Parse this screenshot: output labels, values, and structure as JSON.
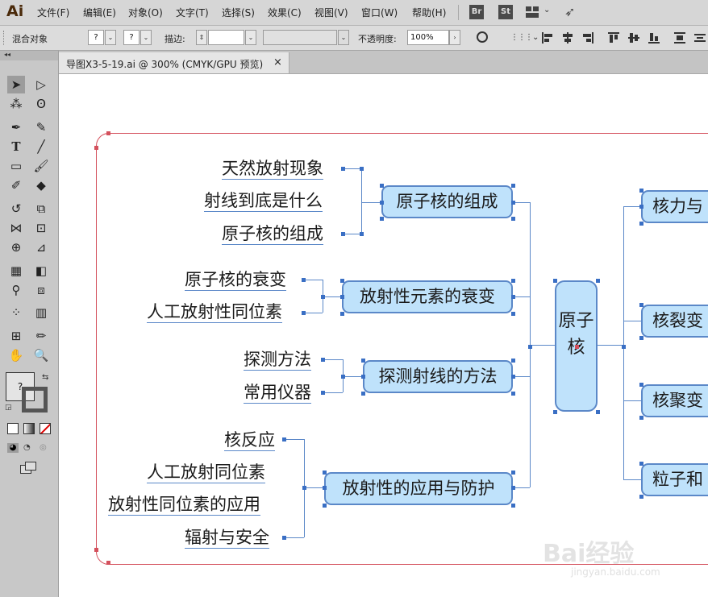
{
  "app": {
    "logo": "Ai"
  },
  "menu": [
    "文件(F)",
    "编辑(E)",
    "对象(O)",
    "文字(T)",
    "选择(S)",
    "效果(C)",
    "视图(V)",
    "窗口(W)",
    "帮助(H)"
  ],
  "menu_badges": [
    "Br",
    "St"
  ],
  "control_bar": {
    "selection_label": "混合对象",
    "fill_value": "?",
    "stroke_value": "?",
    "stroke_label": "描边:",
    "opacity_label": "不透明度:",
    "opacity_value": "100%"
  },
  "document_tab": {
    "title": "导图X3-5-19.ai @ 300% (CMYK/GPU 预览)",
    "close": "×"
  },
  "toolbar": {
    "fill_stroke_value": "?"
  },
  "mindmap": {
    "center": "原子核",
    "groups": [
      {
        "label": "原子核的组成",
        "items": [
          "天然放射现象",
          "射线到底是什么",
          "原子核的组成"
        ]
      },
      {
        "label": "放射性元素的衰变",
        "items": [
          "原子核的衰变",
          "人工放射性同位素"
        ]
      },
      {
        "label": "探测射线的方法",
        "items": [
          "探测方法",
          "常用仪器"
        ]
      },
      {
        "label": "放射性的应用与防护",
        "items": [
          "核反应",
          "人工放射同位素",
          "放射性同位素的应用",
          "辐射与安全"
        ]
      }
    ],
    "right_nodes": [
      "核力与",
      "核裂变",
      "核聚变",
      "粒子和"
    ]
  },
  "watermark": {
    "brand": "Bai经验",
    "url": "jingyan.baidu.com"
  }
}
